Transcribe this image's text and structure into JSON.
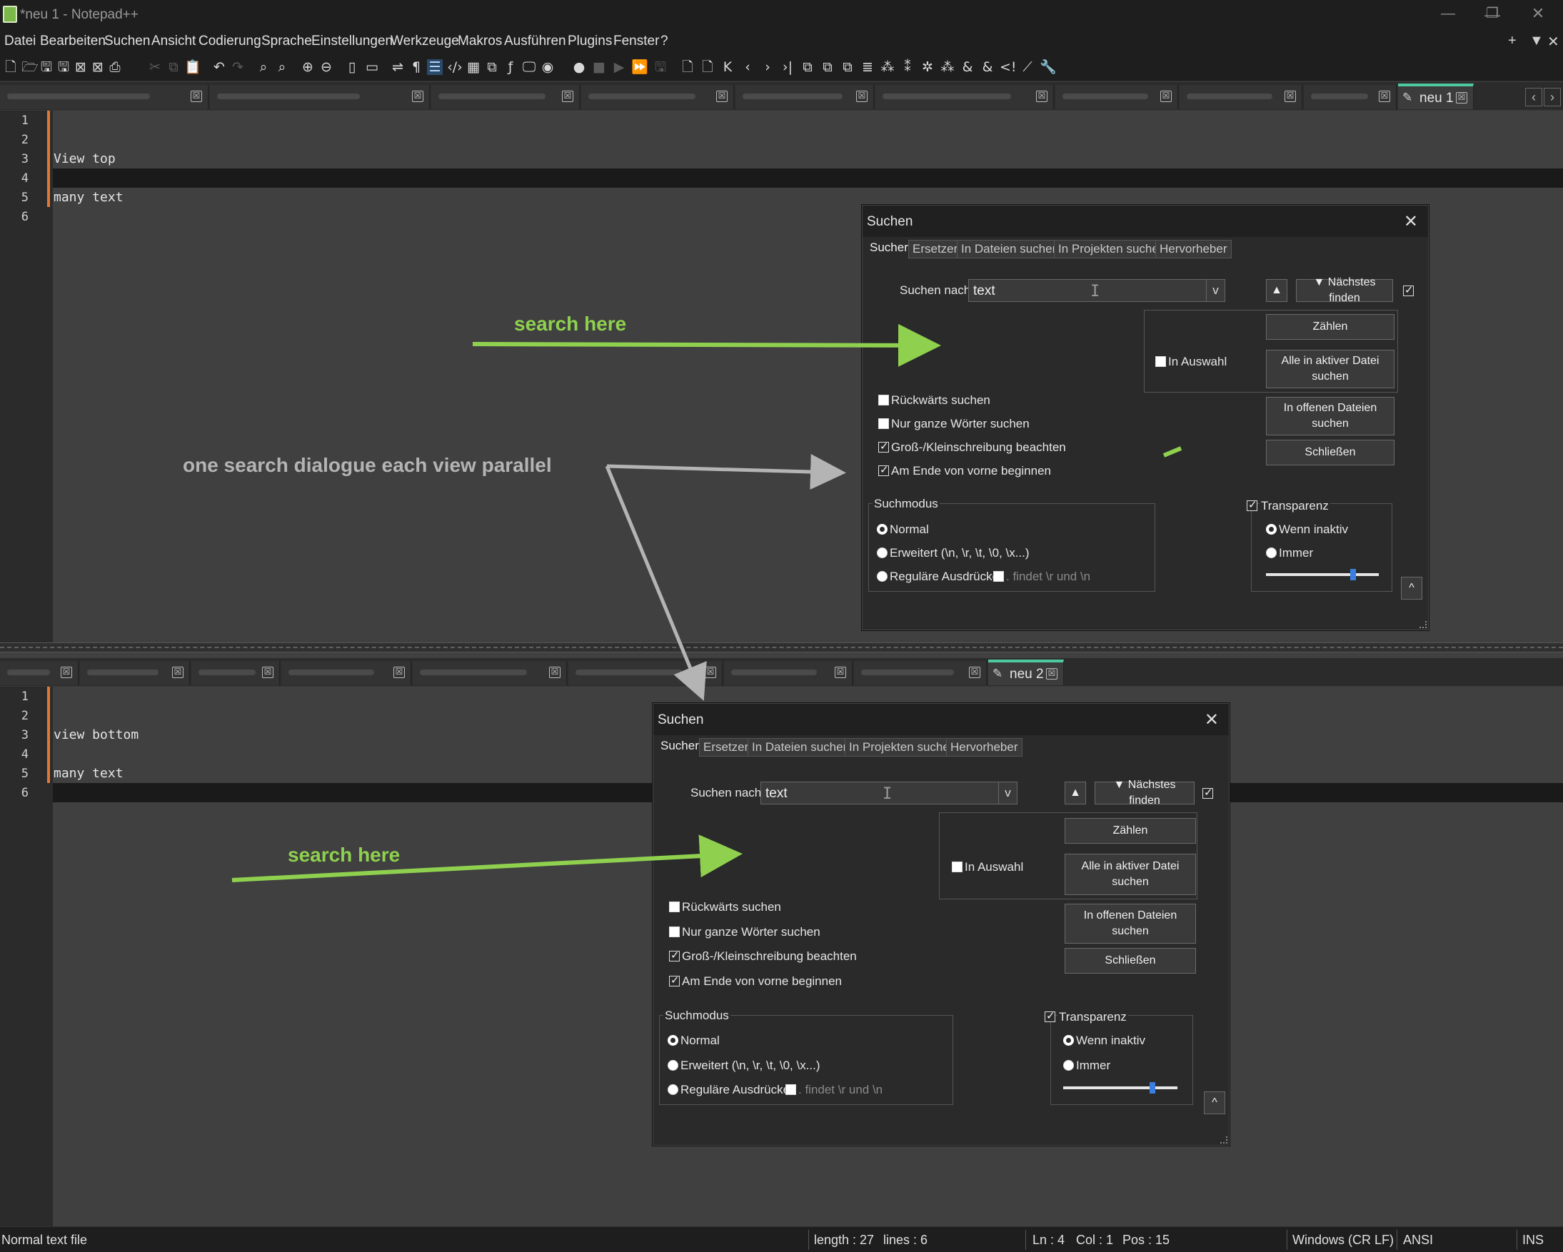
{
  "window": {
    "title": "*neu 1 - Notepad++",
    "controls": {
      "minimize": "—",
      "restore": "❐",
      "close": "✕"
    }
  },
  "menu": {
    "items": [
      "Datei",
      "Bearbeiten",
      "Suchen",
      "Ansicht",
      "Codierung",
      "Sprache",
      "Einstellungen",
      "Werkzeuge",
      "Makros",
      "Ausführen",
      "Plugins",
      "Fenster",
      "?"
    ],
    "right": [
      "+",
      "▼",
      "✕"
    ]
  },
  "top_view": {
    "active_tab": "neu 1",
    "tab_close": "☒",
    "nav": [
      "‹",
      "›"
    ],
    "line_numbers": [
      "1",
      "2",
      "3",
      "4",
      "5",
      "6"
    ],
    "lines": [
      "",
      "",
      "View top",
      "",
      "many text",
      ""
    ]
  },
  "bottom_view": {
    "active_tab": "neu 2",
    "tab_close": "☒",
    "line_numbers": [
      "1",
      "2",
      "3",
      "4",
      "5",
      "6"
    ],
    "lines": [
      "",
      "",
      "view bottom",
      "",
      "many text",
      ""
    ]
  },
  "find_dialog": {
    "title": "Suchen",
    "close": "✕",
    "tabs": [
      "Sucher",
      "Ersetzer",
      "In Dateien sucher",
      "In Projekten sucher",
      "Hervorheber"
    ],
    "find_label": "Suchen nach:",
    "find_value": "text",
    "dropdown": "v",
    "ibeam": "I",
    "prev_button": "▲",
    "next_button": "▼ Nächstes finden",
    "count_button": "Zählen",
    "in_selection": "In Auswahl",
    "find_all_current": "Alle in aktiver Datei suchen",
    "find_all_open": "In offenen Dateien suchen",
    "close_button": "Schließen",
    "options": [
      {
        "label": "Rückwärts suchen",
        "checked": false
      },
      {
        "label": "Nur ganze Wörter suchen",
        "checked": false
      },
      {
        "label": "Groß-/Kleinschreibung beachten",
        "checked": true
      },
      {
        "label": "Am Ende von vorne beginnen",
        "checked": true
      }
    ],
    "search_mode": {
      "title": "Suchmodus",
      "normal": "Normal",
      "extended": "Erweitert (\\n, \\r, \\t, \\0, \\x...)",
      "regex": "Reguläre Ausdrücke",
      "dot_newline": ". findet \\r und \\n",
      "selected": "Normal"
    },
    "transparency": {
      "label": "Transparenz",
      "checked": true,
      "when_inactive": "Wenn inaktiv",
      "always": "Immer",
      "selected": "Wenn inaktiv",
      "level": 0.78
    },
    "collapse": "^"
  },
  "annotations": {
    "search_here_top": "search here",
    "search_here_bottom": "search here",
    "parallel_note": "one search dialogue each view parallel",
    "green": "#8fd14f",
    "gray": "#b4b4b4"
  },
  "statusbar": {
    "file_type": "Normal text file",
    "length": "length : 27",
    "lines": "lines : 6",
    "ln": "Ln : 4",
    "col": "Col : 1",
    "pos": "Pos : 15",
    "eol": "Windows (CR LF)",
    "encoding": "ANSI",
    "mode": "INS"
  },
  "colors": {
    "editor_bg": "#404040",
    "gutter_bg": "#2b2b2b",
    "current_line": "#1a1a1a",
    "fold_accent": "#e07838",
    "tab_accent": "#4ec9a0"
  }
}
